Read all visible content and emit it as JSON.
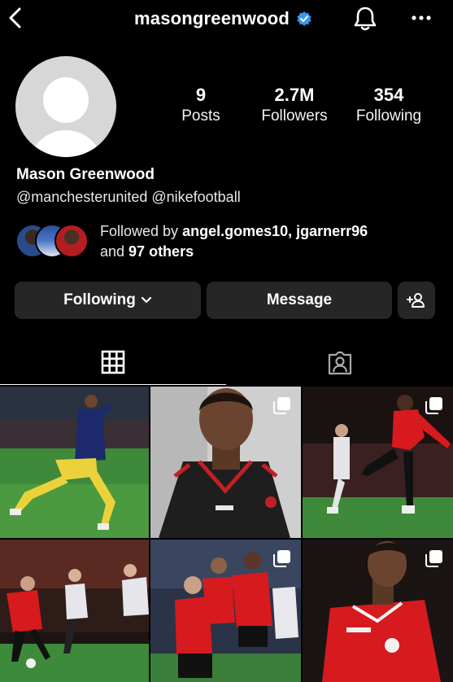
{
  "header": {
    "username": "masongreenwood",
    "icons": [
      "back-arrow-icon",
      "verified-badge-icon",
      "bell-icon",
      "more-options-icon"
    ],
    "verified_color": "#3897f0"
  },
  "profile": {
    "stats": [
      {
        "value": "9",
        "label": "Posts"
      },
      {
        "value": "2.7M",
        "label": "Followers"
      },
      {
        "value": "354",
        "label": "Following"
      }
    ],
    "name": "Mason Greenwood",
    "bio": "@manchesterunited @nikefootball",
    "mutual": {
      "prefix": "Followed by ",
      "names": "angel.gomes10, jgarnerr96",
      "line2_prefix": "and ",
      "others": "97 others"
    }
  },
  "actions": {
    "following_label": "Following",
    "message_label": "Message"
  },
  "tabs": [
    {
      "name": "grid",
      "icon": "grid-icon",
      "selected": true
    },
    {
      "name": "tagged",
      "icon": "tagged-person-icon",
      "selected": false
    }
  ],
  "posts": [
    {
      "subject": "player-in-blue-kit-running",
      "multi": false
    },
    {
      "subject": "player-portrait-black-training-top",
      "multi": true
    },
    {
      "subject": "player-red-kit-running",
      "multi": true
    },
    {
      "subject": "players-red-kit-match",
      "multi": false
    },
    {
      "subject": "team-celebration-red-kits",
      "multi": true
    },
    {
      "subject": "player-back-red-kit",
      "multi": true
    }
  ],
  "colors": {
    "background": "#000000",
    "button_bg": "#262626",
    "united_red": "#d7191c"
  }
}
